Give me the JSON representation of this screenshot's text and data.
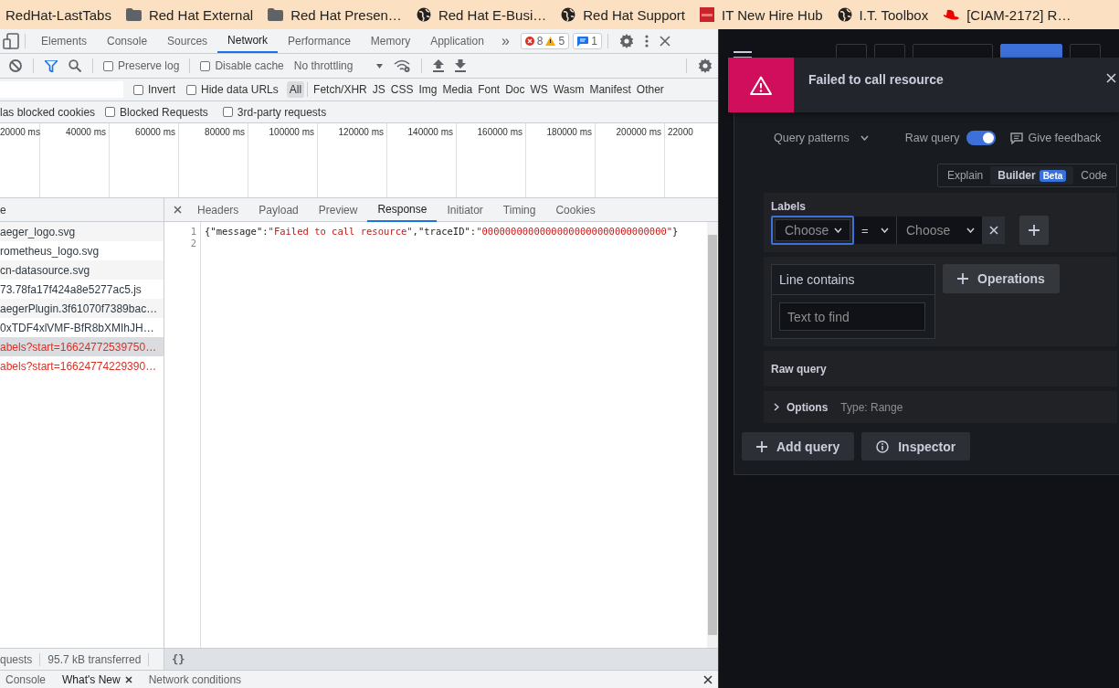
{
  "bookmarks": [
    {
      "label": "RedHat-LastTabs",
      "kind": "plain"
    },
    {
      "label": "Red Hat External",
      "kind": "folder"
    },
    {
      "label": "Red Hat Presen…",
      "kind": "folder"
    },
    {
      "label": "Red Hat E-Busi…",
      "kind": "globe"
    },
    {
      "label": "Red Hat Support",
      "kind": "globe"
    },
    {
      "label": "IT New Hire Hub",
      "kind": "square"
    },
    {
      "label": "I.T. Toolbox",
      "kind": "globe"
    },
    {
      "label": "[CIAM-2172] R…",
      "kind": "hat"
    }
  ],
  "devtools": {
    "tabs": [
      {
        "label": "Elements",
        "selected": false
      },
      {
        "label": "Console",
        "selected": false
      },
      {
        "label": "Sources",
        "selected": false
      },
      {
        "label": "Network",
        "selected": true
      },
      {
        "label": "Performance",
        "selected": false
      },
      {
        "label": "Memory",
        "selected": false
      },
      {
        "label": "Application",
        "selected": false
      }
    ],
    "overflow": "»",
    "issues": {
      "errors": "8",
      "warnings": "5",
      "messages": "1"
    },
    "toolbar": {
      "preserve_log": {
        "label": "Preserve log",
        "checked": false
      },
      "disable_cache": {
        "label": "Disable cache",
        "checked": false
      },
      "throttling": "No throttling"
    },
    "filter": {
      "invert": {
        "label": "Invert",
        "checked": false
      },
      "hide_data_urls": {
        "label": "Hide data URLs",
        "checked": false
      },
      "types": [
        {
          "label": "All",
          "selected": true
        },
        {
          "label": "Fetch/XHR",
          "selected": false
        },
        {
          "label": "JS",
          "selected": false
        },
        {
          "label": "CSS",
          "selected": false
        },
        {
          "label": "Img",
          "selected": false
        },
        {
          "label": "Media",
          "selected": false
        },
        {
          "label": "Font",
          "selected": false
        },
        {
          "label": "Doc",
          "selected": false
        },
        {
          "label": "WS",
          "selected": false
        },
        {
          "label": "Wasm",
          "selected": false
        },
        {
          "label": "Manifest",
          "selected": false
        },
        {
          "label": "Other",
          "selected": false
        }
      ]
    },
    "options": [
      {
        "label": "las blocked cookies",
        "kind": "cut"
      },
      {
        "label": "Blocked Requests",
        "checked": false,
        "kind": "checkbox"
      },
      {
        "label": "3rd-party requests",
        "checked": false,
        "kind": "checkbox"
      }
    ],
    "timeline": [
      "20000 ms",
      "40000 ms",
      "60000 ms",
      "80000 ms",
      "100000 ms",
      "120000 ms",
      "140000 ms",
      "160000 ms",
      "180000 ms",
      "200000 ms",
      "22000"
    ],
    "requests": {
      "header": "e",
      "rows": [
        {
          "name": "aeger_logo.svg",
          "failed": false,
          "selected": false
        },
        {
          "name": "rometheus_logo.svg",
          "failed": false,
          "selected": false
        },
        {
          "name": "cn-datasource.svg",
          "failed": false,
          "selected": false
        },
        {
          "name": "73.78fa17f424a8e5277ac5.js",
          "failed": false,
          "selected": false
        },
        {
          "name": "aegerPlugin.3f61070f7389bac…",
          "failed": false,
          "selected": false
        },
        {
          "name": "0xTDF4xlVMF-BfR8bXMIhJH…",
          "failed": false,
          "selected": false
        },
        {
          "name": "abels?start=16624772539750…",
          "failed": true,
          "selected": true
        },
        {
          "name": "abels?start=16624774229390…",
          "failed": true,
          "selected": false
        }
      ]
    },
    "detail_tabs": [
      {
        "label": "Headers",
        "selected": false
      },
      {
        "label": "Payload",
        "selected": false
      },
      {
        "label": "Preview",
        "selected": false
      },
      {
        "label": "Response",
        "selected": true
      },
      {
        "label": "Initiator",
        "selected": false
      },
      {
        "label": "Timing",
        "selected": false
      },
      {
        "label": "Cookies",
        "selected": false
      }
    ],
    "response_lines": [
      {
        "number": "1",
        "tokens": [
          {
            "text": "{",
            "kind": "punct"
          },
          {
            "text": "\"message\"",
            "kind": "key"
          },
          {
            "text": ":",
            "kind": "punct"
          },
          {
            "text": "\"Failed to call resource\"",
            "kind": "string"
          },
          {
            "text": ",",
            "kind": "punct"
          },
          {
            "text": "\"traceID\"",
            "kind": "key"
          },
          {
            "text": ":",
            "kind": "punct"
          },
          {
            "text": "\"00000000000000000000000000000000\"",
            "kind": "string"
          },
          {
            "text": "}",
            "kind": "punct"
          }
        ]
      },
      {
        "number": "2"
      }
    ],
    "status": [
      "quests",
      "95.7 kB transferred"
    ],
    "pretty_print": "{}",
    "drawer_tabs": [
      {
        "label": "Console",
        "selected": false,
        "closable": false
      },
      {
        "label": "What's New",
        "selected": true,
        "closable": true
      },
      {
        "label": "Network conditions",
        "selected": false,
        "closable": false
      }
    ]
  },
  "grafana": {
    "toast": {
      "message": "Failed to call resource"
    },
    "query_patterns": "Query patterns",
    "raw_query_toggle": {
      "label": "Raw query",
      "on": true
    },
    "feedback": "Give feedback",
    "modes": [
      {
        "label": "Explain",
        "selected": false
      },
      {
        "label": "Builder",
        "selected": true,
        "badge": "Beta"
      },
      {
        "label": "Code",
        "selected": false
      }
    ],
    "labels": {
      "title": "Labels",
      "key": {
        "placeholder": "Choose"
      },
      "operator": "=",
      "value": {
        "placeholder": "Choose"
      }
    },
    "line_filter": {
      "title": "Line contains",
      "placeholder": "Text to find"
    },
    "operations": "Operations",
    "raw_query": "Raw query",
    "options": {
      "title": "Options",
      "type": "Type: Range"
    },
    "buttons": [
      {
        "label": "Add query",
        "kind": "add"
      },
      {
        "label": "Inspector",
        "kind": "inspect"
      }
    ]
  }
}
